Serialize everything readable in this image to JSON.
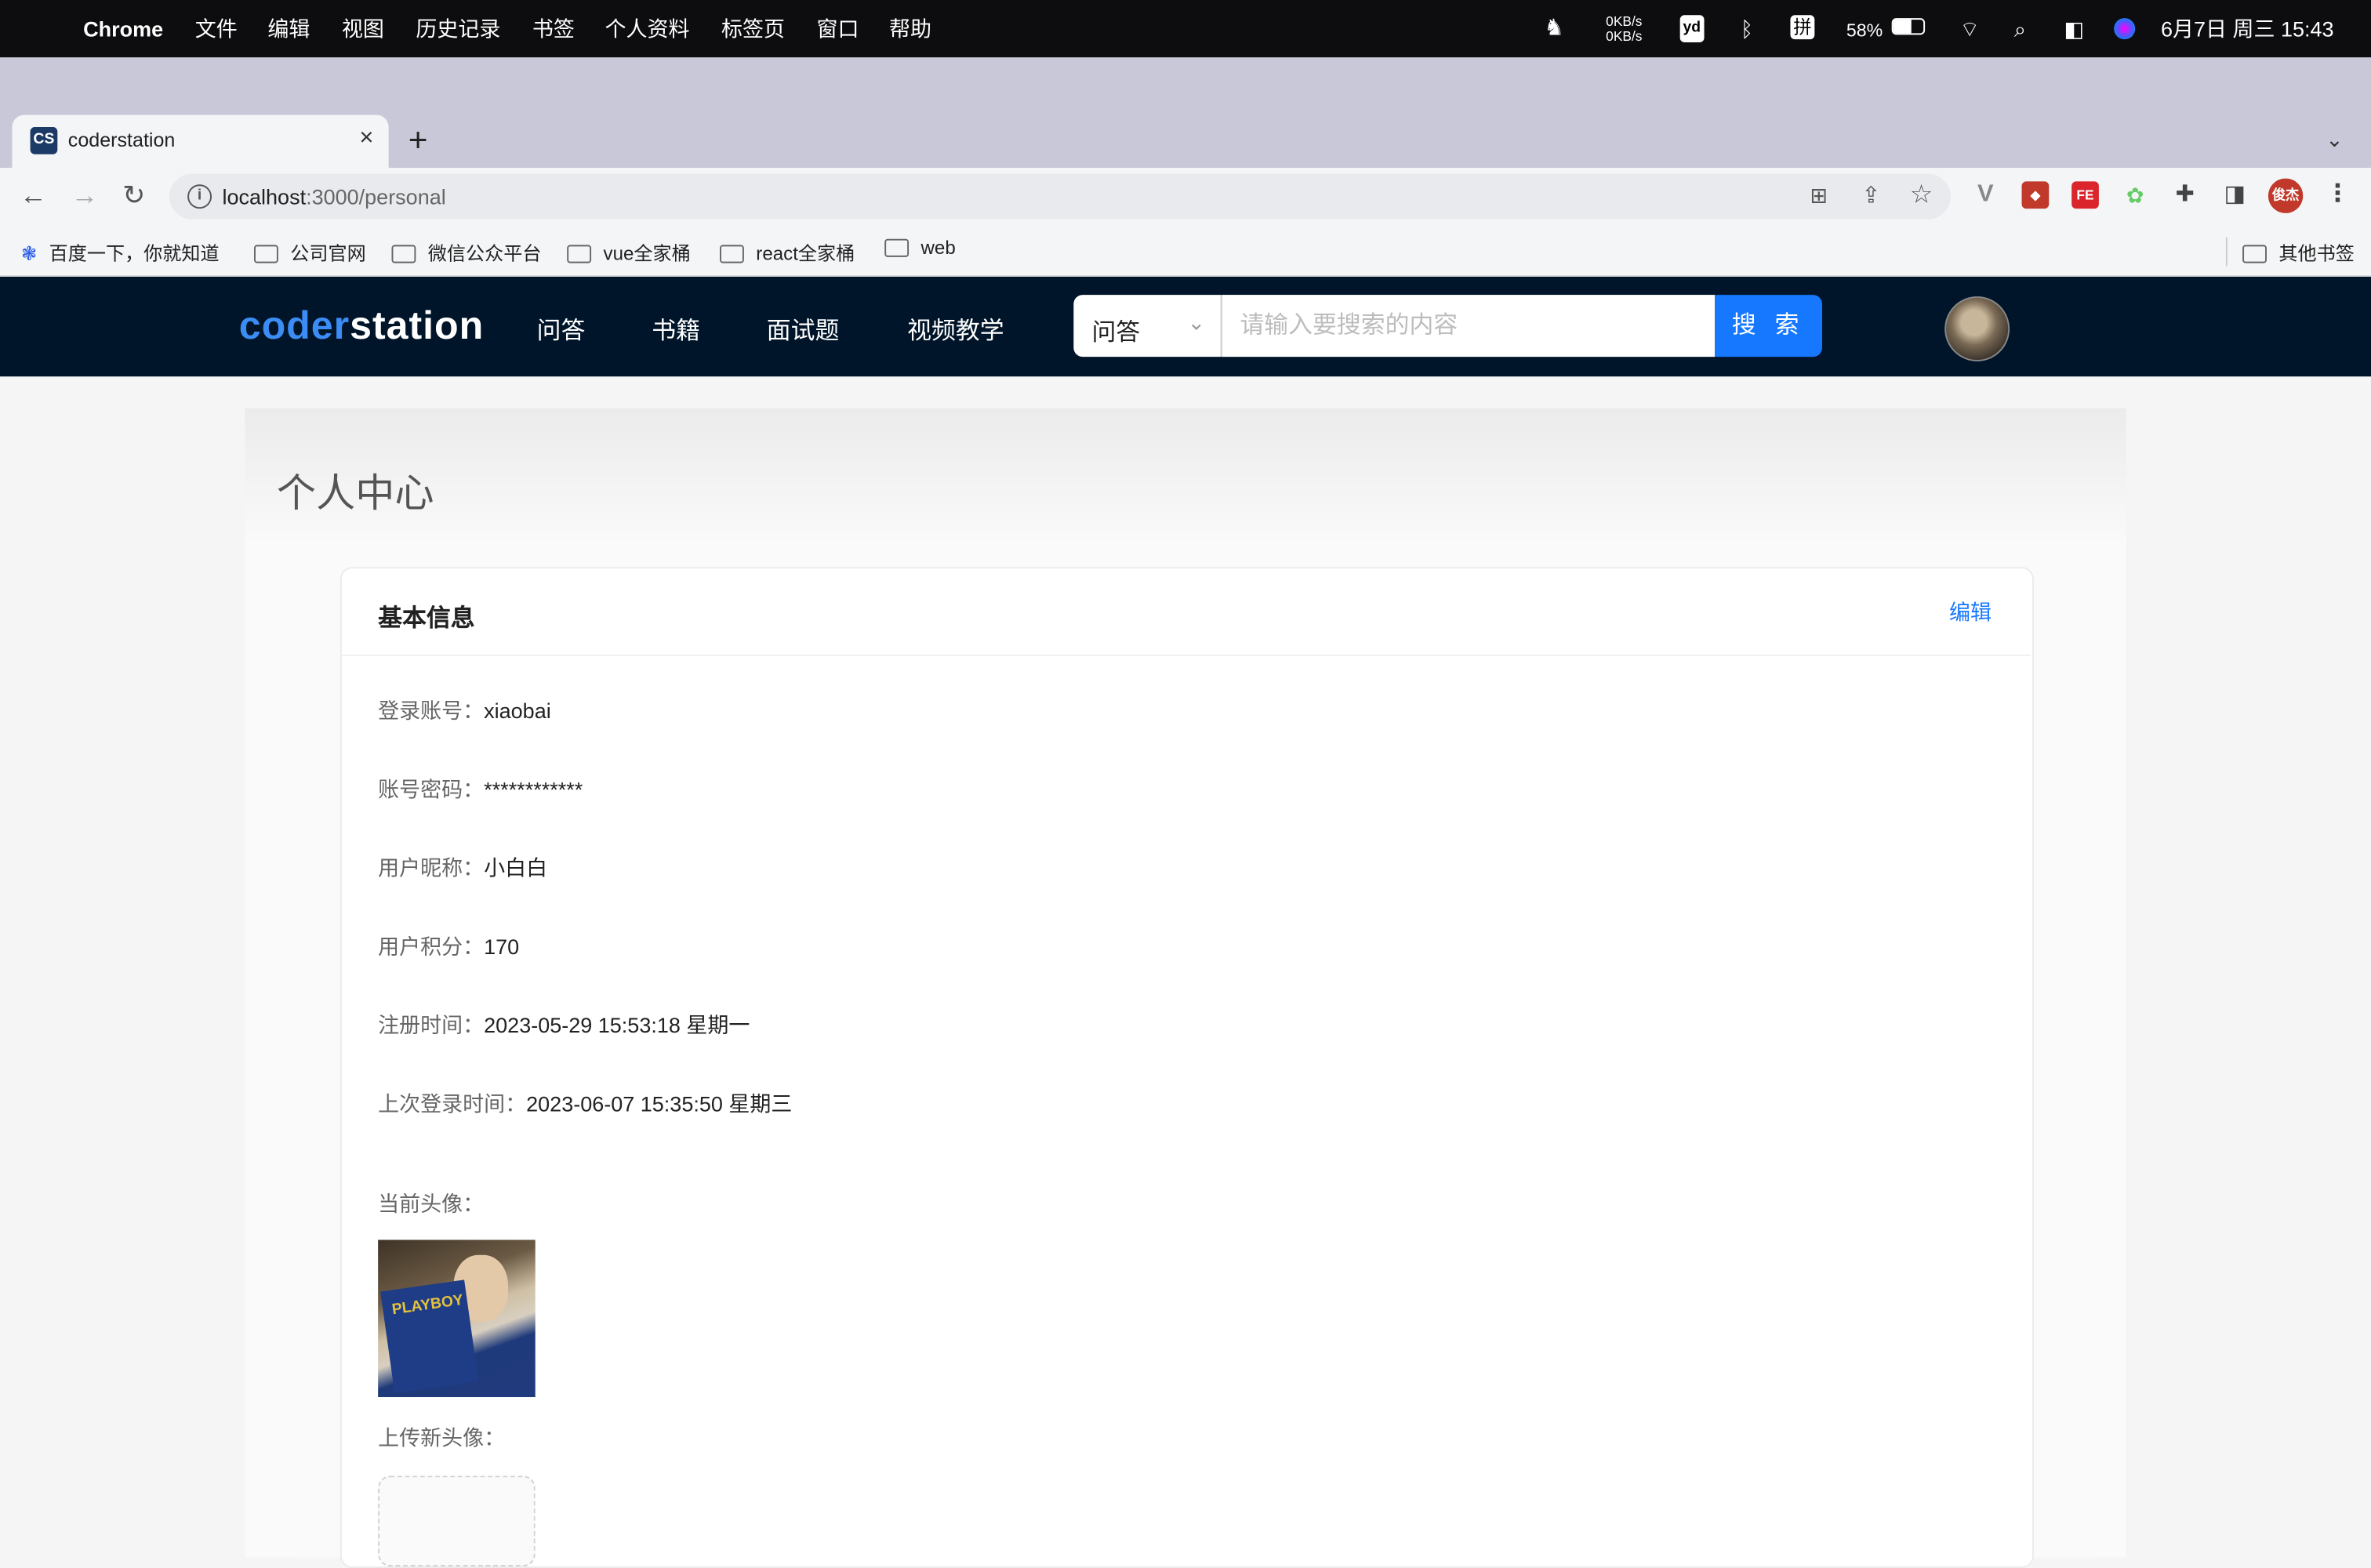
{
  "menubar": {
    "app": "Chrome",
    "items": [
      "文件",
      "编辑",
      "视图",
      "历史记录",
      "书签",
      "个人资料",
      "标签页",
      "窗口",
      "帮助"
    ],
    "net_up": "0KB/s",
    "net_down": "0KB/s",
    "yd": "yd",
    "ime": "拼",
    "battery": "58%",
    "datetime": "6月7日 周三 15:43"
  },
  "browser": {
    "tab_title": "coderstation",
    "tab_favicon": "CS",
    "url_host": "localhost",
    "url_path": ":3000/personal",
    "profile": "俊杰",
    "bookmarks": [
      "百度一下，你就知道",
      "公司官网",
      "微信公众平台",
      "vue全家桶",
      "react全家桶",
      "web"
    ],
    "other_bookmarks": "其他书签"
  },
  "site": {
    "logo_a": "coder",
    "logo_b": "station",
    "nav": [
      "问答",
      "书籍",
      "面试题",
      "视频教学"
    ],
    "search_category": "问答",
    "search_placeholder": "请输入要搜索的内容",
    "search_button": "搜 索"
  },
  "page": {
    "title": "个人中心",
    "card_title": "基本信息",
    "edit": "编辑",
    "fields": [
      {
        "label": "登录账号：",
        "value": "xiaobai"
      },
      {
        "label": "账号密码：",
        "value": "************"
      },
      {
        "label": "用户昵称：",
        "value": "小白白"
      },
      {
        "label": "用户积分：",
        "value": "170"
      },
      {
        "label": "注册时间：",
        "value": "2023-05-29 15:53:18 星期一"
      },
      {
        "label": "上次登录时间：",
        "value": "2023-06-07 15:35:50 星期三"
      }
    ],
    "current_avatar_label": "当前头像：",
    "current_avatar_text": "PLAYBOY",
    "upload_label": "上传新头像："
  },
  "colors": {
    "header_bg": "#001529",
    "accent": "#1677ff",
    "logo_blue": "#3b8cf5"
  }
}
